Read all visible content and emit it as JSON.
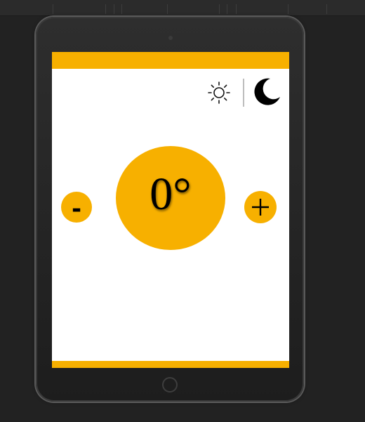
{
  "thermostat": {
    "temperature": "0°",
    "decrease_label": "-"
  },
  "icons": {
    "sun": "sun-icon",
    "moon": "moon-icon",
    "plus": "plus-icon"
  },
  "colors": {
    "accent": "#f7b000",
    "screen": "#ffffff",
    "background": "#222222",
    "device": "#1d1d1d"
  }
}
